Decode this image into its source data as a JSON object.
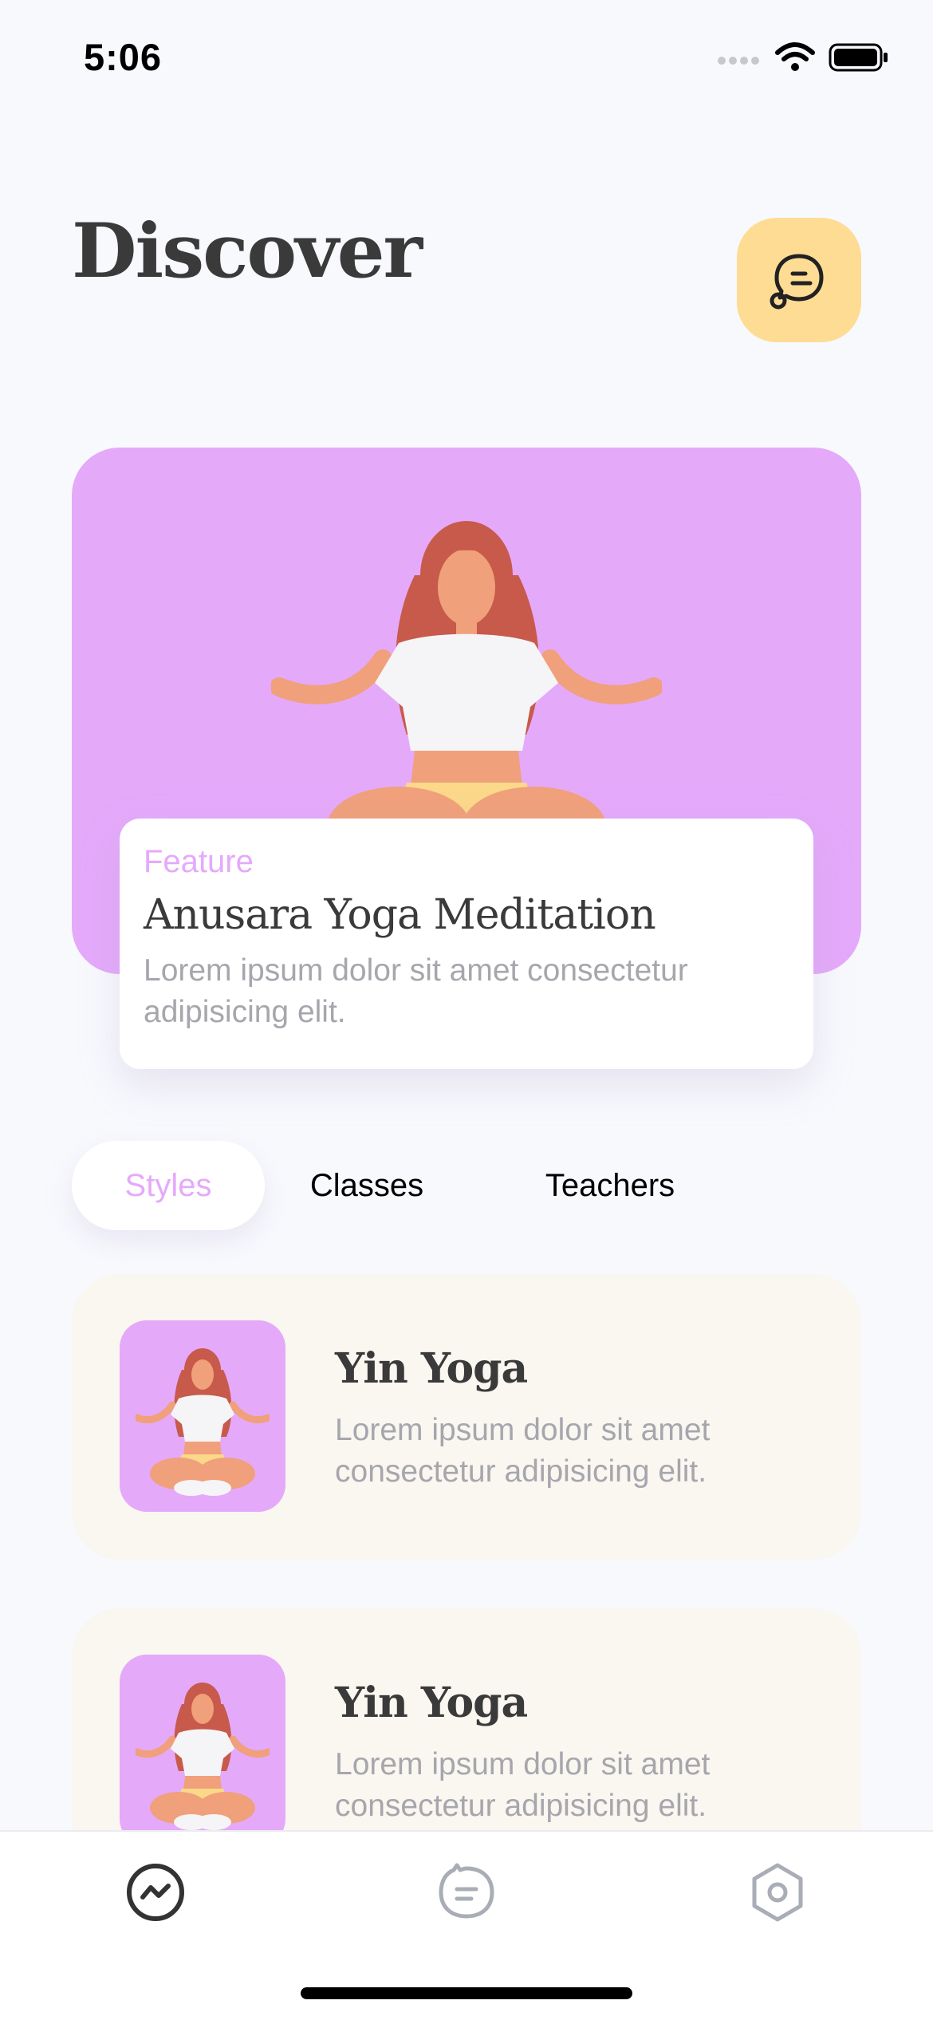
{
  "status": {
    "time": "5:06"
  },
  "header": {
    "title": "Discover",
    "chat_icon": "chat-bubble-icon"
  },
  "featured": {
    "tag": "Feature",
    "title": "Anusara Yoga Meditation",
    "description": "Lorem ipsum dolor sit amet consectetur adipisicing elit.",
    "background_color": "#e5a9fa"
  },
  "tabs": [
    {
      "label": "Styles",
      "active": true
    },
    {
      "label": "Classes",
      "active": false
    },
    {
      "label": "Teachers",
      "active": false
    }
  ],
  "styles": [
    {
      "title": "Yin Yoga",
      "description": "Lorem ipsum dolor sit amet consectetur adipisicing elit."
    },
    {
      "title": "Yin Yoga",
      "description": "Lorem ipsum dolor sit amet consectetur adipisicing elit."
    }
  ],
  "tab_bar": {
    "items": [
      {
        "icon": "activity-icon",
        "active": true
      },
      {
        "icon": "chat-icon",
        "active": false
      },
      {
        "icon": "settings-icon",
        "active": false
      }
    ]
  },
  "colors": {
    "accent": "#e5a9fa",
    "chat_button": "#fedc94",
    "card_bg": "#faf6f0",
    "title": "#3a3a3a",
    "muted": "#a6a6ad"
  }
}
